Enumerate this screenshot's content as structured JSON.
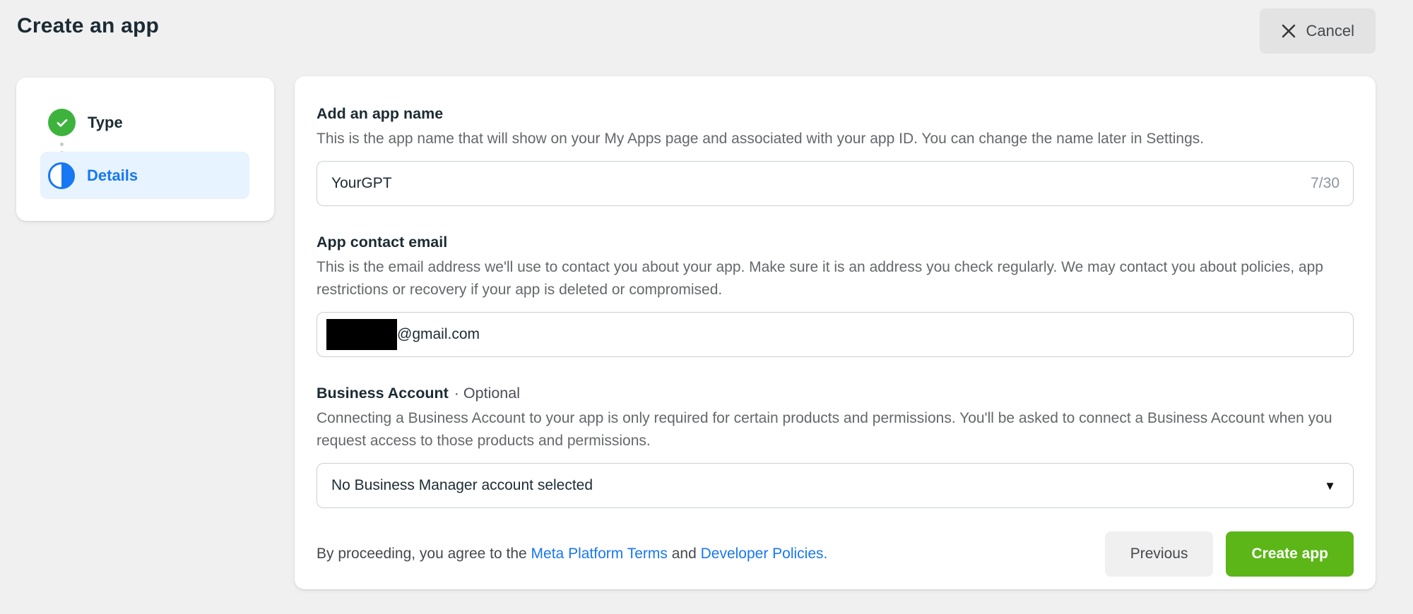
{
  "header": {
    "title": "Create an app",
    "cancel": {
      "label": "Cancel",
      "icon": "close-icon"
    }
  },
  "stepper": {
    "steps": [
      {
        "label": "Type",
        "state": "complete",
        "icon": "check-circle-icon"
      },
      {
        "label": "Details",
        "state": "active",
        "icon": "half-filled-circle-icon"
      }
    ]
  },
  "form": {
    "app_name": {
      "label": "Add an app name",
      "description": "This is the app name that will show on your My Apps page and associated with your app ID. You can change the name later in Settings.",
      "value": "YourGPT",
      "counter": "7/30"
    },
    "contact_email": {
      "label": "App contact email",
      "description": "This is the email address we'll use to contact you about your app. Make sure it is an address you check regularly. We may contact you about policies, app restrictions or recovery if your app is deleted or compromised.",
      "value_visible": "@gmail.com",
      "value_redacted": true
    },
    "business_account": {
      "label": "Business Account",
      "optional_tag": "· Optional",
      "description": "Connecting a Business Account to your app is only required for certain products and permissions. You'll be asked to connect a Business Account when you request access to those products and permissions.",
      "selected_value": "No Business Manager account selected",
      "caret_icon": "caret-down-icon",
      "caret_glyph": "▼"
    }
  },
  "footer": {
    "terms": {
      "prefix": "By proceeding, you agree to the ",
      "link_meta_terms": "Meta Platform Terms",
      "connector": " and ",
      "link_dev_policies": "Developer Policies."
    },
    "previous_label": "Previous",
    "create_label": "Create app"
  },
  "colors": {
    "accent_blue": "#1877f2",
    "success_green": "#3db33d",
    "create_button_green": "#5cb618",
    "active_step_bg": "#e7f3ff",
    "page_bg": "#f0f0f1",
    "input_border": "#ccd0d5"
  }
}
